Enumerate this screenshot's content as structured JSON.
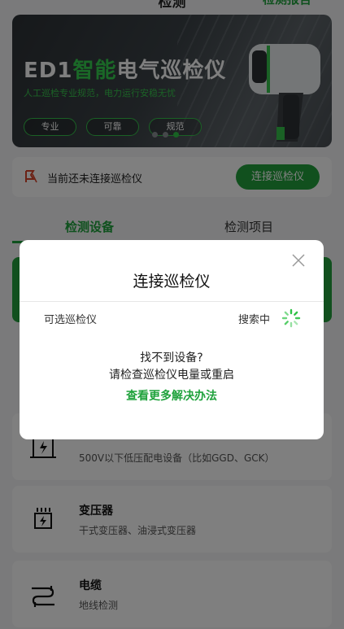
{
  "header": {
    "title": "检测",
    "right_action": "检测报告"
  },
  "banner": {
    "title_prefix": "ED1",
    "title_highlight": "智能",
    "title_suffix": "电气巡检仪",
    "subtitle": "人工巡检专业规范，电力运行安稳无忧",
    "chips": [
      "专业",
      "可靠",
      "规范"
    ],
    "pagination": {
      "total": 3,
      "active_index": 2
    }
  },
  "connect_bar": {
    "message": "当前还未连接巡检仪",
    "button": "连接巡检仪"
  },
  "tabs": [
    {
      "label": "检测设备",
      "active": true
    },
    {
      "label": "检测项目",
      "active": false
    }
  ],
  "device_list": [
    {
      "name": "",
      "desc": "500V以下低压配电设备（比如GGD、GCK）",
      "icon": "low-voltage-cabinet-icon"
    },
    {
      "name": "变压器",
      "desc": "干式变压器、油浸式变压器",
      "icon": "transformer-icon"
    },
    {
      "name": "电缆",
      "desc": "地线检测",
      "icon": "cable-icon"
    }
  ],
  "modal": {
    "title": "连接巡检仪",
    "available_label": "可选巡检仪",
    "status": "搜索中",
    "not_found": "找不到设备?",
    "hint": "请检查巡检仪电量或重启",
    "more_link": "查看更多解决办法"
  },
  "colors": {
    "primary": "#22a13c",
    "overlay": "rgba(0,0,0,0.5)"
  }
}
